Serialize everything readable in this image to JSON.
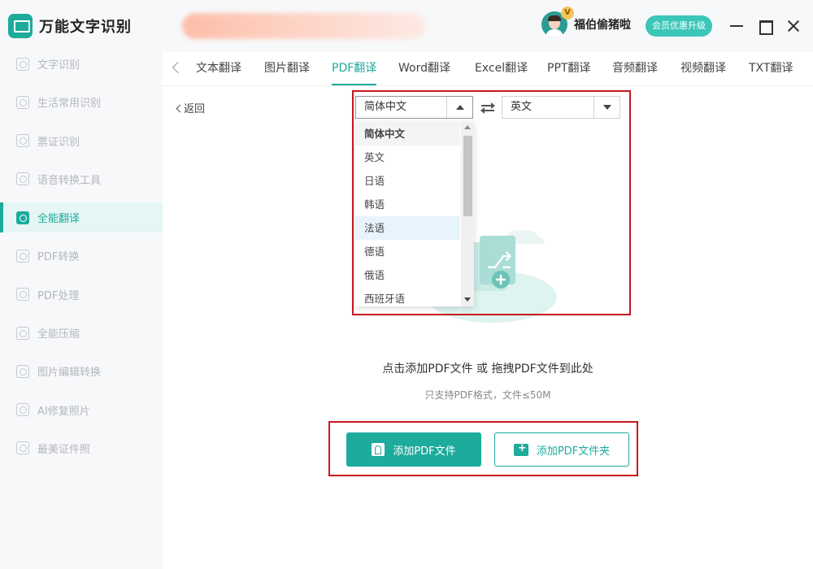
{
  "app": {
    "name": "万能文字识别"
  },
  "sidebar": {
    "items": [
      {
        "label": "文字识别",
        "icon": "text-scan-icon"
      },
      {
        "label": "生活常用识别",
        "icon": "scan-icon"
      },
      {
        "label": "票证识别",
        "icon": "ticket-scan-icon"
      },
      {
        "label": "语音转换工具",
        "icon": "audio-convert-icon"
      },
      {
        "label": "全能翻译",
        "icon": "translate-icon",
        "active": true
      },
      {
        "label": "PDF转换",
        "icon": "pdf-convert-icon"
      },
      {
        "label": "PDF处理",
        "icon": "pdf-process-icon"
      },
      {
        "label": "全能压缩",
        "icon": "compress-icon"
      },
      {
        "label": "图片编辑转换",
        "icon": "image-edit-icon"
      },
      {
        "label": "AI修复照片",
        "icon": "ai-repair-icon"
      },
      {
        "label": "最美证件照",
        "icon": "id-photo-icon"
      }
    ]
  },
  "header": {
    "username": "福伯偷猪啦",
    "vip_badge": "V",
    "upgrade_label": "会员优惠升级"
  },
  "tabs": [
    {
      "label": "文本翻译"
    },
    {
      "label": "图片翻译"
    },
    {
      "label": "PDF翻译",
      "active": true
    },
    {
      "label": "Word翻译"
    },
    {
      "label": "Excel翻译"
    },
    {
      "label": "PPT翻译"
    },
    {
      "label": "音频翻译"
    },
    {
      "label": "视频翻译"
    },
    {
      "label": "TXT翻译"
    }
  ],
  "back_label": "返回",
  "source_language": "简体中文",
  "target_language": "英文",
  "language_options": [
    "简体中文",
    "英文",
    "日语",
    "韩语",
    "法语",
    "德语",
    "俄语",
    "西班牙语"
  ],
  "upload": {
    "instruction": "点击添加PDF文件 或 拖拽PDF文件到此处",
    "hint": "只支持PDF格式，文件≤50M",
    "add_file_label": "添加PDF文件",
    "add_folder_label": "添加PDF文件夹"
  },
  "colors": {
    "accent": "#1dab9c",
    "highlight_box": "#c8161d"
  }
}
